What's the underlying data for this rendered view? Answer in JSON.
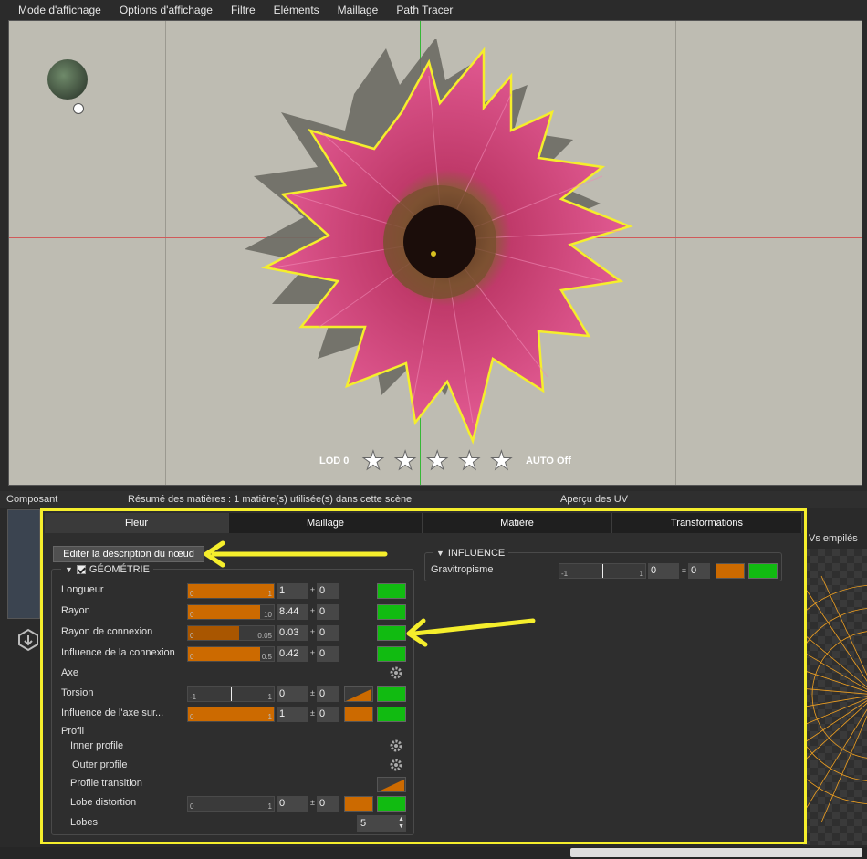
{
  "menu": [
    "Mode d'affichage",
    "Options d'affichage",
    "Filtre",
    "Eléments",
    "Maillage",
    "Path Tracer"
  ],
  "viewport": {
    "lod_label": "LOD 0",
    "stars": 5,
    "auto_label": "AUTO Off"
  },
  "lower_headers": {
    "composant": "Composant",
    "summary": "Résumé des matières : 1 matière(s) utilisée(s) dans cette scène",
    "uv_preview": "Aperçu des UV",
    "uv_stacked": "Vs empilés"
  },
  "tabs": [
    {
      "label": "Fleur",
      "active": true
    },
    {
      "label": "Maillage",
      "active": false
    },
    {
      "label": "Matière",
      "active": false
    },
    {
      "label": "Transformations",
      "active": false
    }
  ],
  "edit_button": "Editer la description du nœud",
  "geometry": {
    "title": "GÉOMÉTRIE",
    "checked": true,
    "rows": [
      {
        "label": "Longueur",
        "min": "0",
        "max": "1",
        "fill": 1.0,
        "value": "1",
        "var": "0"
      },
      {
        "label": "Rayon",
        "min": "0",
        "max": "10",
        "fill": 0.844,
        "value": "8.44",
        "var": "0"
      },
      {
        "label": "Rayon de connexion",
        "min": "0",
        "max": "0.05",
        "fill": 0.6,
        "value": "0.03",
        "var": "0"
      },
      {
        "label": "Influence de la connexion",
        "min": "0",
        "max": "0.5",
        "fill": 0.84,
        "value": "0.42",
        "var": "0"
      },
      {
        "label": "Axe"
      },
      {
        "label": "Torsion",
        "min": "-1",
        "max": "1",
        "value": "0",
        "var": "0"
      },
      {
        "label": "Influence de l'axe sur...",
        "min": "0",
        "max": "1",
        "fill": 1.0,
        "value": "1",
        "var": "0"
      },
      {
        "label": "Profil"
      },
      {
        "label": "Inner profile"
      },
      {
        "label": "Outer profile"
      },
      {
        "label": "Profile transition"
      },
      {
        "label": "Lobe distortion",
        "min": "0",
        "max": "1",
        "value": "0",
        "var": "0"
      },
      {
        "label": "Lobes",
        "value": "5"
      }
    ]
  },
  "influence": {
    "title": "INFLUENCE",
    "row": {
      "label": "Gravitropisme",
      "min": "-1",
      "max": "1",
      "value": "0",
      "var": "0"
    }
  },
  "colors": {
    "highlight": "#f5ee2c",
    "orange": "#cc6a00",
    "green": "#11bb11"
  }
}
